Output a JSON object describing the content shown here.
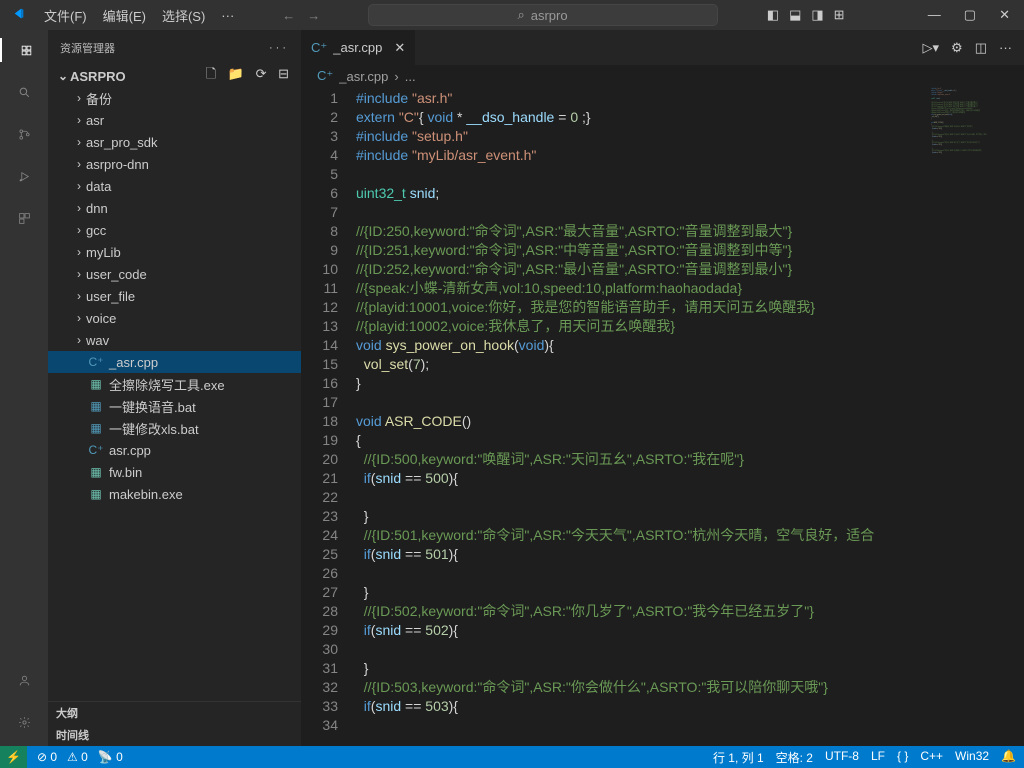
{
  "titlebar": {
    "menu": [
      "文件(F)",
      "编辑(E)",
      "选择(S)",
      "···"
    ],
    "search_text": "asrpro"
  },
  "sidebar": {
    "title": "资源管理器",
    "root": "ASRPRO",
    "folders": [
      "备份",
      "asr",
      "asr_pro_sdk",
      "asrpro-dnn",
      "data",
      "dnn",
      "gcc",
      "myLib",
      "user_code",
      "user_file",
      "voice",
      "wav"
    ],
    "files": [
      {
        "name": "_asr.cpp",
        "icon": "cpp",
        "selected": true
      },
      {
        "name": "全擦除烧写工具.exe",
        "icon": "exe"
      },
      {
        "name": "一键换语音.bat",
        "icon": "bat"
      },
      {
        "name": "一键修改xls.bat",
        "icon": "bat"
      },
      {
        "name": "asr.cpp",
        "icon": "cpp"
      },
      {
        "name": "fw.bin",
        "icon": "exe"
      },
      {
        "name": "makebin.exe",
        "icon": "exe"
      }
    ],
    "outline": "大纲",
    "timeline": "时间线"
  },
  "editor": {
    "tab_name": "_asr.cpp",
    "breadcrumb": "_asr.cpp",
    "breadcrumb_sep": "›",
    "breadcrumb_more": "...",
    "lines": [
      [
        [
          "kw",
          "#include"
        ],
        [
          "pun",
          " "
        ],
        [
          "str",
          "\"asr.h\""
        ]
      ],
      [
        [
          "kw",
          "extern"
        ],
        [
          "pun",
          " "
        ],
        [
          "str",
          "\"C\""
        ],
        [
          "pun",
          "{ "
        ],
        [
          "kw",
          "void"
        ],
        [
          "pun",
          " * "
        ],
        [
          "var",
          "__dso_handle"
        ],
        [
          "pun",
          " = "
        ],
        [
          "num",
          "0"
        ],
        [
          "pun",
          " ;}"
        ]
      ],
      [
        [
          "kw",
          "#include"
        ],
        [
          "pun",
          " "
        ],
        [
          "str",
          "\"setup.h\""
        ]
      ],
      [
        [
          "kw",
          "#include"
        ],
        [
          "pun",
          " "
        ],
        [
          "str",
          "\"myLib/asr_event.h\""
        ]
      ],
      [
        [
          "pun",
          ""
        ]
      ],
      [
        [
          "type",
          "uint32_t"
        ],
        [
          "pun",
          " "
        ],
        [
          "var",
          "snid"
        ],
        [
          "pun",
          ";"
        ]
      ],
      [
        [
          "pun",
          ""
        ]
      ],
      [
        [
          "com",
          "//{ID:250,keyword:\"命令词\",ASR:\"最大音量\",ASRTO:\"音量调整到最大\"}"
        ]
      ],
      [
        [
          "com",
          "//{ID:251,keyword:\"命令词\",ASR:\"中等音量\",ASRTO:\"音量调整到中等\"}"
        ]
      ],
      [
        [
          "com",
          "//{ID:252,keyword:\"命令词\",ASR:\"最小音量\",ASRTO:\"音量调整到最小\"}"
        ]
      ],
      [
        [
          "com",
          "//{speak:小蝶-清新女声,vol:10,speed:10,platform:haohaodada}"
        ]
      ],
      [
        [
          "com",
          "//{playid:10001,voice:你好，我是您的智能语音助手，请用天问五幺唤醒我}"
        ]
      ],
      [
        [
          "com",
          "//{playid:10002,voice:我休息了，用天问五幺唤醒我}"
        ]
      ],
      [
        [
          "kw",
          "void"
        ],
        [
          "pun",
          " "
        ],
        [
          "fn",
          "sys_power_on_hook"
        ],
        [
          "pun",
          "("
        ],
        [
          "kw",
          "void"
        ],
        [
          "pun",
          "){"
        ]
      ],
      [
        [
          "pun",
          "  "
        ],
        [
          "fn",
          "vol_set"
        ],
        [
          "pun",
          "("
        ],
        [
          "num",
          "7"
        ],
        [
          "pun",
          ");"
        ]
      ],
      [
        [
          "pun",
          "}"
        ]
      ],
      [
        [
          "pun",
          ""
        ]
      ],
      [
        [
          "kw",
          "void"
        ],
        [
          "pun",
          " "
        ],
        [
          "fn",
          "ASR_CODE"
        ],
        [
          "pun",
          "()"
        ]
      ],
      [
        [
          "pun",
          "{"
        ]
      ],
      [
        [
          "pun",
          "  "
        ],
        [
          "com",
          "//{ID:500,keyword:\"唤醒词\",ASR:\"天问五幺\",ASRTO:\"我在呢\"}"
        ]
      ],
      [
        [
          "pun",
          "  "
        ],
        [
          "kw",
          "if"
        ],
        [
          "pun",
          "("
        ],
        [
          "var",
          "snid"
        ],
        [
          "pun",
          " == "
        ],
        [
          "num",
          "500"
        ],
        [
          "pun",
          "){"
        ]
      ],
      [
        [
          "pun",
          ""
        ]
      ],
      [
        [
          "pun",
          "  }"
        ]
      ],
      [
        [
          "pun",
          "  "
        ],
        [
          "com",
          "//{ID:501,keyword:\"命令词\",ASR:\"今天天气\",ASRTO:\"杭州今天晴，空气良好，适合"
        ]
      ],
      [
        [
          "pun",
          "  "
        ],
        [
          "kw",
          "if"
        ],
        [
          "pun",
          "("
        ],
        [
          "var",
          "snid"
        ],
        [
          "pun",
          " == "
        ],
        [
          "num",
          "501"
        ],
        [
          "pun",
          "){"
        ]
      ],
      [
        [
          "pun",
          ""
        ]
      ],
      [
        [
          "pun",
          "  }"
        ]
      ],
      [
        [
          "pun",
          "  "
        ],
        [
          "com",
          "//{ID:502,keyword:\"命令词\",ASR:\"你几岁了\",ASRTO:\"我今年已经五岁了\"}"
        ]
      ],
      [
        [
          "pun",
          "  "
        ],
        [
          "kw",
          "if"
        ],
        [
          "pun",
          "("
        ],
        [
          "var",
          "snid"
        ],
        [
          "pun",
          " == "
        ],
        [
          "num",
          "502"
        ],
        [
          "pun",
          "){"
        ]
      ],
      [
        [
          "pun",
          ""
        ]
      ],
      [
        [
          "pun",
          "  }"
        ]
      ],
      [
        [
          "pun",
          "  "
        ],
        [
          "com",
          "//{ID:503,keyword:\"命令词\",ASR:\"你会做什么\",ASRTO:\"我可以陪你聊天哦\"}"
        ]
      ],
      [
        [
          "pun",
          "  "
        ],
        [
          "kw",
          "if"
        ],
        [
          "pun",
          "("
        ],
        [
          "var",
          "snid"
        ],
        [
          "pun",
          " == "
        ],
        [
          "num",
          "503"
        ],
        [
          "pun",
          "){"
        ]
      ],
      [
        [
          "pun",
          ""
        ]
      ]
    ]
  },
  "statusbar": {
    "errors": "0",
    "warnings": "0",
    "port": "0",
    "line_col": "行 1, 列 1",
    "spaces": "空格: 2",
    "encoding": "UTF-8",
    "eol": "LF",
    "lang_brace": "{ }",
    "lang": "C++",
    "platform": "Win32"
  }
}
